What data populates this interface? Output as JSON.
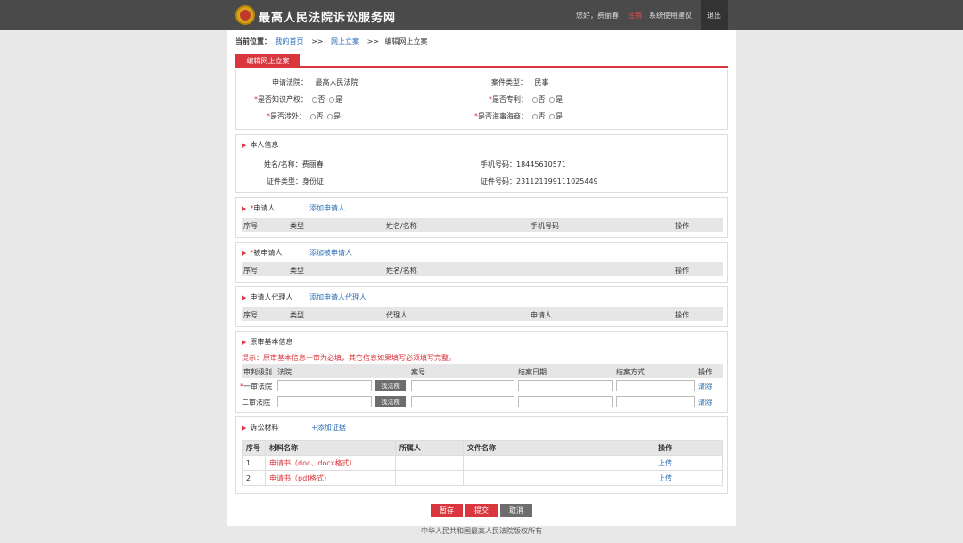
{
  "header": {
    "title": "最高人民法院诉讼服务网",
    "greeting": "您好，费丽春",
    "red_link": "注销",
    "suggest": "系统使用建议",
    "logout": "退出"
  },
  "breadcrumb": {
    "label": "当前位置：",
    "items": [
      "我的首页",
      "网上立案",
      "编辑网上立案"
    ],
    "sep": ">>"
  },
  "tab": "编辑网上立案",
  "case_info": {
    "court_label": "申请法院：",
    "court_value": "最高人民法院",
    "type_label": "案件类型：",
    "type_value": "民事",
    "ip_label": "是否知识产权：",
    "patent_label": "是否专利：",
    "foreign_label": "是否涉外：",
    "maritime_label": "是否海事海商：",
    "opt_no": "否",
    "opt_yes": "是",
    "req": "*"
  },
  "personal": {
    "title": "本人信息",
    "name_label": "姓名/名称：",
    "name_value": "费丽春",
    "phone_label": "手机号码：",
    "phone_value": "18445610571",
    "idtype_label": "证件类型：",
    "idtype_value": "身份证",
    "idno_label": "证件号码：",
    "idno_value": "231121199111025449"
  },
  "applicant": {
    "title": "申请人",
    "add_link": "添加申请人",
    "cols": [
      "序号",
      "类型",
      "姓名/名称",
      "手机号码",
      "操作"
    ]
  },
  "respondent": {
    "title": "被申请人",
    "add_link": "添加被申请人",
    "cols": [
      "序号",
      "类型",
      "姓名/名称",
      "操作"
    ]
  },
  "agent": {
    "title": "申请人代理人",
    "add_link": "添加申请人代理人",
    "cols": [
      "序号",
      "类型",
      "代理人",
      "申请人",
      "操作"
    ]
  },
  "original": {
    "title": "原审基本信息",
    "warning": "提示：原审基本信息一审为必填，其它信息如果填写必须填写完整。",
    "cols": [
      "审判级别",
      "法院",
      "案号",
      "结案日期",
      "结案方式",
      "操作"
    ],
    "row1_label": "一审法院",
    "row2_label": "二审法院",
    "select_btn": "找法院",
    "clear": "清除"
  },
  "materials": {
    "title": "诉讼材料",
    "add_link": "+添加证据",
    "cols": [
      "序号",
      "材料名称",
      "所属人",
      "文件名称",
      "操作"
    ],
    "rows": [
      {
        "no": "1",
        "name": "申请书（doc、docx格式）",
        "owner": "",
        "file": "",
        "op": "上传"
      },
      {
        "no": "2",
        "name": "申请书（pdf格式）",
        "owner": "",
        "file": "",
        "op": "上传"
      }
    ]
  },
  "buttons": {
    "save": "暂存",
    "submit": "提交",
    "cancel": "取消"
  },
  "footer": "中华人民共和国最高人民法院版权所有",
  "colors": {
    "accent": "#d9363e",
    "link": "#2a6db5",
    "header_bg": "#4a4a4a",
    "cancel_bg": "#6d6d6d"
  }
}
